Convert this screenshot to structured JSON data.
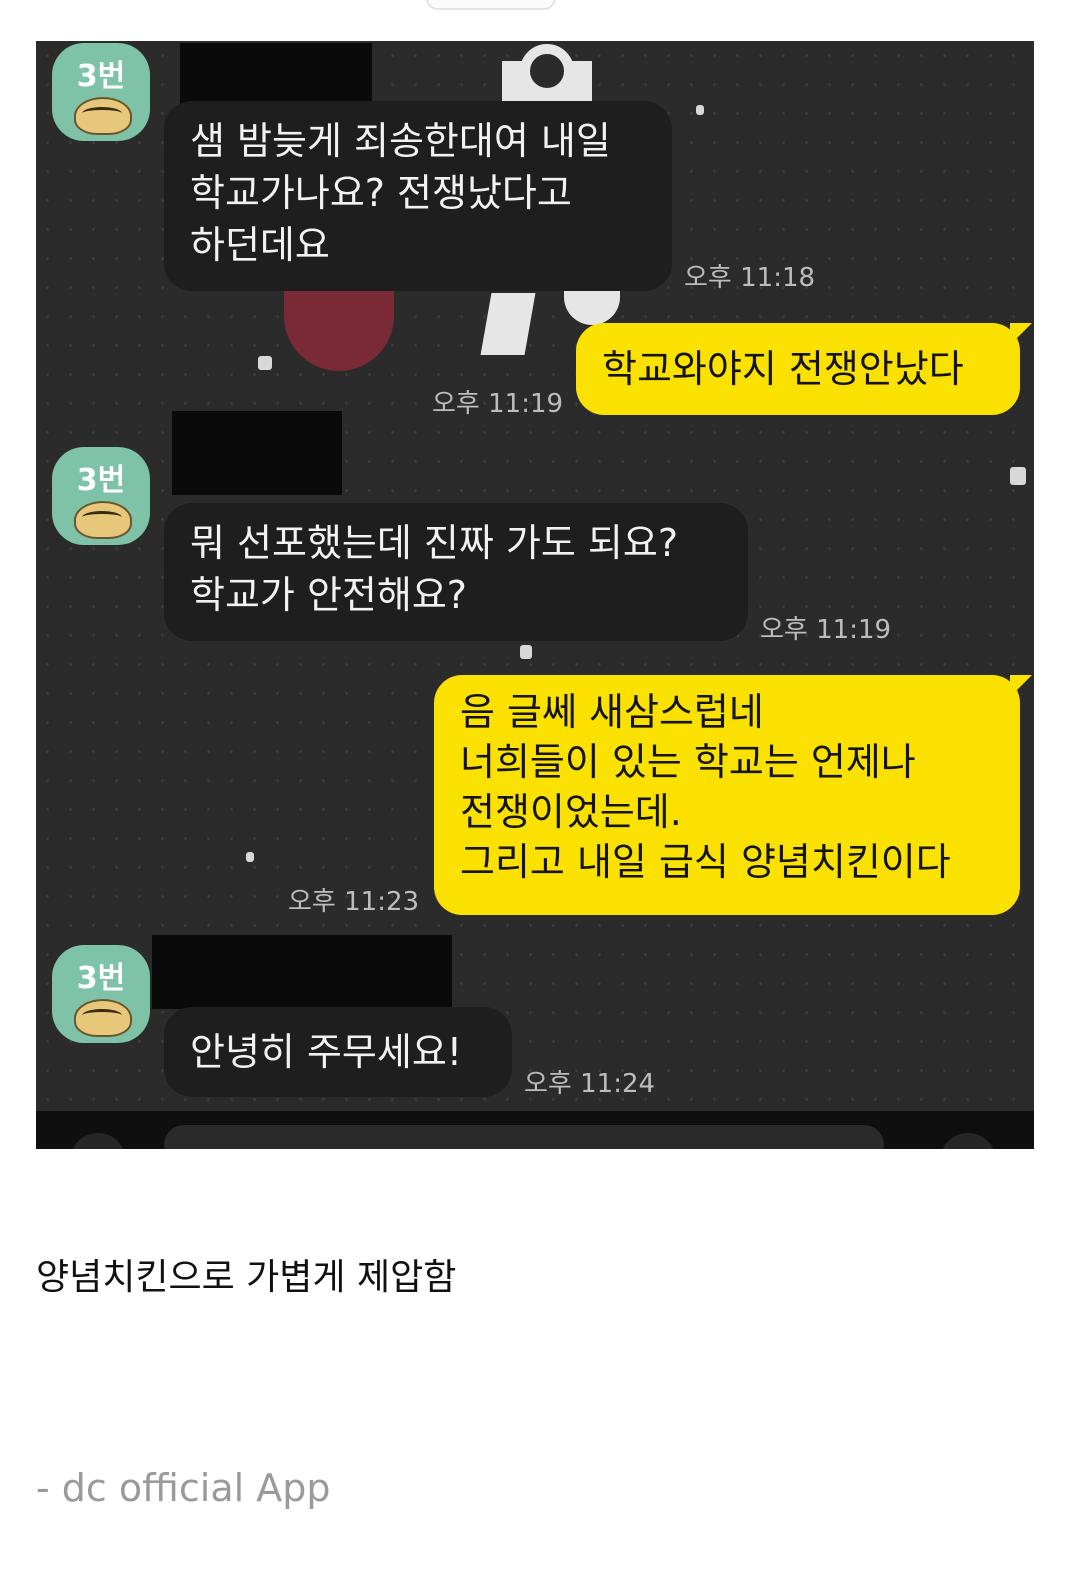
{
  "chat": {
    "sender_label": "3번",
    "messages": [
      {
        "dir": "in",
        "text": "샘 밤늦게 죄송한대여 내일\n학교가나요? 전쟁났다고\n하던데요",
        "time": "오후 11:18"
      },
      {
        "dir": "out",
        "text": "학교와야지 전쟁안났다",
        "time": "오후 11:19"
      },
      {
        "dir": "in",
        "text": "뭐 선포했는데 진짜 가도 되요?\n학교가 안전해요?",
        "time": "오후 11:19"
      },
      {
        "dir": "out",
        "text": "음 글쎄 새삼스럽네\n너희들이 있는 학교는 언제나\n전쟁이었는데.\n그리고 내일 급식  양념치킨이다",
        "time": "오후 11:23"
      },
      {
        "dir": "in",
        "text": "안녕히 주무세요!",
        "time": "오후 11:24"
      }
    ]
  },
  "post": {
    "caption": "양념치킨으로 가볍게 제압함",
    "footer": "- dc official App"
  },
  "colors": {
    "chat_background": "#2b2b2b",
    "incoming_bubble": "#1e1e1e",
    "outgoing_bubble": "#fae100",
    "avatar": "#7ec3a8"
  }
}
